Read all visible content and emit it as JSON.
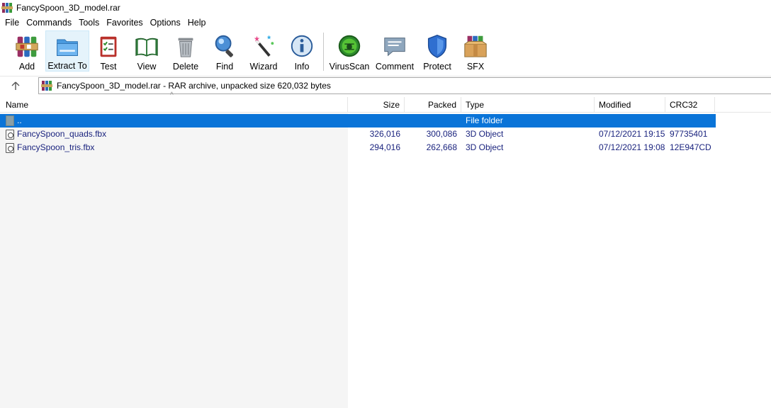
{
  "window": {
    "title": "FancySpoon_3D_model.rar"
  },
  "menu": [
    "File",
    "Commands",
    "Tools",
    "Favorites",
    "Options",
    "Help"
  ],
  "toolbar": {
    "items": [
      {
        "label": "Add",
        "icon": "add-archive-icon"
      },
      {
        "label": "Extract To",
        "icon": "extract-folder-icon"
      },
      {
        "label": "Test",
        "icon": "test-clipboard-icon"
      },
      {
        "label": "View",
        "icon": "view-book-icon"
      },
      {
        "label": "Delete",
        "icon": "trash-icon"
      },
      {
        "label": "Find",
        "icon": "magnifier-icon"
      },
      {
        "label": "Wizard",
        "icon": "magic-wand-icon"
      },
      {
        "label": "Info",
        "icon": "info-icon"
      },
      {
        "label": "VirusScan",
        "icon": "virus-scan-icon"
      },
      {
        "label": "Comment",
        "icon": "comment-icon"
      },
      {
        "label": "Protect",
        "icon": "shield-icon"
      },
      {
        "label": "SFX",
        "icon": "sfx-box-icon"
      }
    ]
  },
  "address": {
    "path": "FancySpoon_3D_model.rar - RAR archive, unpacked size 620,032 bytes"
  },
  "columns": {
    "name": "Name",
    "size": "Size",
    "packed": "Packed",
    "type": "Type",
    "modified": "Modified",
    "crc": "CRC32"
  },
  "rows": [
    {
      "name": "..",
      "size": "",
      "packed": "",
      "type": "File folder",
      "modified": "",
      "crc": "",
      "selected": true
    },
    {
      "name": "FancySpoon_quads.fbx",
      "size": "326,016",
      "packed": "300,086",
      "type": "3D Object",
      "modified": "07/12/2021 19:15",
      "crc": "97735401"
    },
    {
      "name": "FancySpoon_tris.fbx",
      "size": "294,016",
      "packed": "262,668",
      "type": "3D Object",
      "modified": "07/12/2021 19:08",
      "crc": "12E947CD"
    }
  ],
  "colors": {
    "selection": "#0a74d8",
    "file_text": "#1a237e"
  }
}
